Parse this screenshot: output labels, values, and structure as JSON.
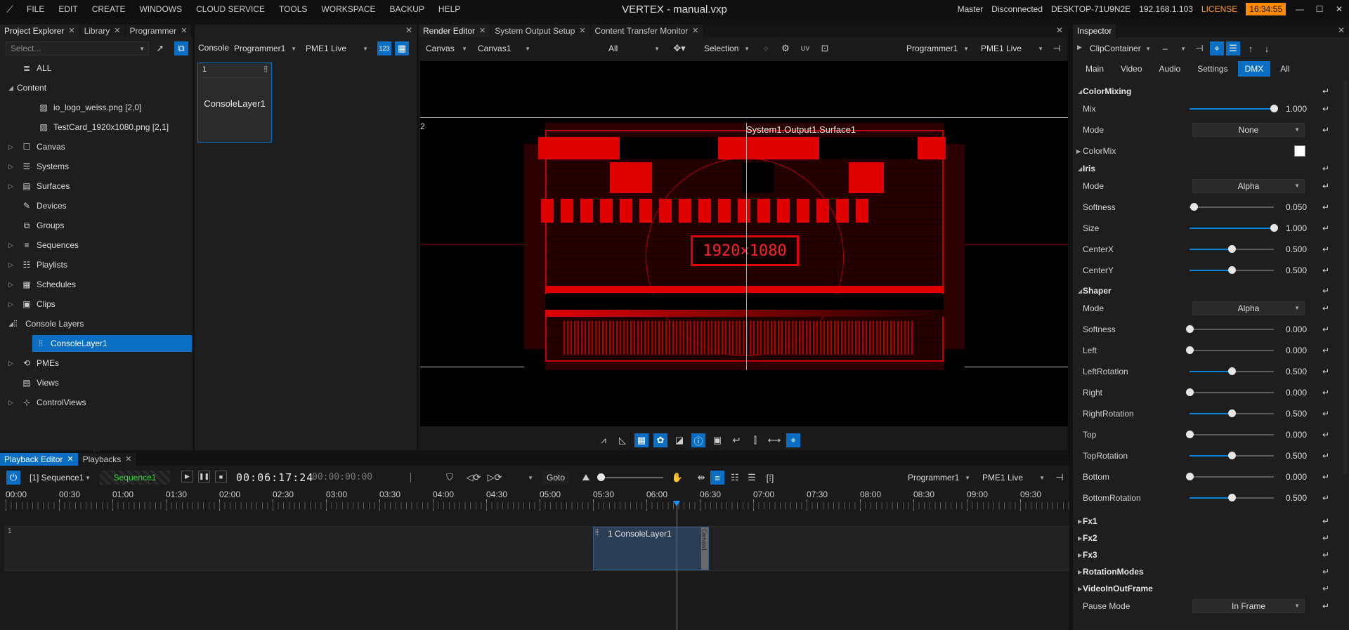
{
  "titlebar": {
    "menu": [
      "FILE",
      "EDIT",
      "CREATE",
      "WINDOWS",
      "CLOUD SERVICE",
      "TOOLS",
      "WORKSPACE",
      "BACKUP",
      "HELP"
    ],
    "title": "VERTEX - manual.vxp",
    "role": "Master",
    "status": "Disconnected",
    "host": "DESKTOP-71U9N2E",
    "ip": "192.168.1.103",
    "license": "LICENSE",
    "clock": "16:34:55"
  },
  "explorer": {
    "tabs": [
      "Project Explorer",
      "Library",
      "Programmer"
    ],
    "select_placeholder": "Select...",
    "items": [
      {
        "label": "ALL",
        "icon": "database-icon"
      },
      {
        "label": "Content",
        "icon": "none",
        "expanded": true
      },
      {
        "label": "io_logo_weiss.png [2,0]",
        "icon": "image-icon"
      },
      {
        "label": "TestCard_1920x1080.png [2,1]",
        "icon": "image-icon"
      },
      {
        "label": "Canvas",
        "icon": "canvas-icon"
      },
      {
        "label": "Systems",
        "icon": "systems-icon"
      },
      {
        "label": "Surfaces",
        "icon": "surfaces-icon"
      },
      {
        "label": "Devices",
        "icon": "devices-icon"
      },
      {
        "label": "Groups",
        "icon": "groups-icon"
      },
      {
        "label": "Sequences",
        "icon": "sequences-icon"
      },
      {
        "label": "Playlists",
        "icon": "playlists-icon"
      },
      {
        "label": "Schedules",
        "icon": "schedules-icon"
      },
      {
        "label": "Clips",
        "icon": "clips-icon"
      },
      {
        "label": "Console Layers",
        "icon": "console-icon",
        "expanded": true
      },
      {
        "label": "ConsoleLayer1",
        "icon": "console-icon",
        "selected": true
      },
      {
        "label": "PMEs",
        "icon": "pme-icon"
      },
      {
        "label": "Views",
        "icon": "views-icon"
      },
      {
        "label": "ControlViews",
        "icon": "controlviews-icon"
      }
    ]
  },
  "console": {
    "label": "Console",
    "programmer": "Programmer1",
    "pme": "PME1 Live",
    "cell_index": "1",
    "cell_name": "ConsoleLayer1"
  },
  "render": {
    "tabs": [
      "Render Editor",
      "System Output Setup",
      "Content Transfer Monitor"
    ],
    "canvas_mode": "Canvas",
    "canvas": "Canvas1",
    "filter": "All",
    "selection": "Selection",
    "programmer": "Programmer1",
    "pme": "PME1 Live",
    "surface_label": "System1.Output1.Surface1",
    "edge_label": "2",
    "testcard_text": "1920×1080"
  },
  "inspector": {
    "title": "Inspector",
    "object": "ClipContainer",
    "object2": "–",
    "tabs": [
      "Main",
      "Video",
      "Audio",
      "Settings",
      "DMX",
      "All"
    ],
    "active_tab": "DMX",
    "colormixing": {
      "title": "ColorMixing",
      "mix_label": "Mix",
      "mix_value": "1.000",
      "mix_level": 1.0,
      "mode_label": "Mode",
      "mode_value": "None",
      "colormix_label": "ColorMix"
    },
    "iris": {
      "title": "Iris",
      "mode_label": "Mode",
      "mode_value": "Alpha",
      "rows": [
        {
          "label": "Softness",
          "value": "0.050",
          "level": 0.05
        },
        {
          "label": "Size",
          "value": "1.000",
          "level": 1.0
        },
        {
          "label": "CenterX",
          "value": "0.500",
          "level": 0.5
        },
        {
          "label": "CenterY",
          "value": "0.500",
          "level": 0.5
        }
      ]
    },
    "shaper": {
      "title": "Shaper",
      "mode_label": "Mode",
      "mode_value": "Alpha",
      "rows": [
        {
          "label": "Softness",
          "value": "0.000",
          "level": 0.0
        },
        {
          "label": "Left",
          "value": "0.000",
          "level": 0.0
        },
        {
          "label": "LeftRotation",
          "value": "0.500",
          "level": 0.5
        },
        {
          "label": "Right",
          "value": "0.000",
          "level": 0.0
        },
        {
          "label": "RightRotation",
          "value": "0.500",
          "level": 0.5
        },
        {
          "label": "Top",
          "value": "0.000",
          "level": 0.0
        },
        {
          "label": "TopRotation",
          "value": "0.500",
          "level": 0.5
        },
        {
          "label": "Bottom",
          "value": "0.000",
          "level": 0.0
        },
        {
          "label": "BottomRotation",
          "value": "0.500",
          "level": 0.5
        }
      ]
    },
    "collapsed": [
      "Fx1",
      "Fx2",
      "Fx3",
      "RotationModes",
      "VideoInOutFrame"
    ],
    "pause_label": "Pause Mode",
    "pause_value": "In Frame"
  },
  "playback": {
    "tabs": [
      "Playback Editor",
      "Playbacks"
    ],
    "sequence": "[1] Sequence1",
    "sequence_badge": "Sequence1",
    "timecode": "00:06:17:24",
    "timecode2": "00:00:00:00",
    "goto": "Goto",
    "programmer": "Programmer1",
    "pme": "PME1 Live",
    "ruler": [
      "00:00",
      "00:30",
      "01:00",
      "01:30",
      "02:00",
      "02:30",
      "03:00",
      "03:30",
      "04:00",
      "04:30",
      "05:00",
      "05:30",
      "06:00",
      "06:30",
      "07:00",
      "07:30",
      "08:00",
      "08:30",
      "09:00",
      "09:30"
    ],
    "track_index": "1",
    "clip_label": "1 ConsoleLayer1",
    "clip_side": "Canvas1",
    "playhead_seconds": 377
  },
  "colors": {
    "accent": "#0a6fc2",
    "license": "#ff9a2a",
    "clock": "#ff8a00",
    "testcard_red": "#e00000"
  }
}
